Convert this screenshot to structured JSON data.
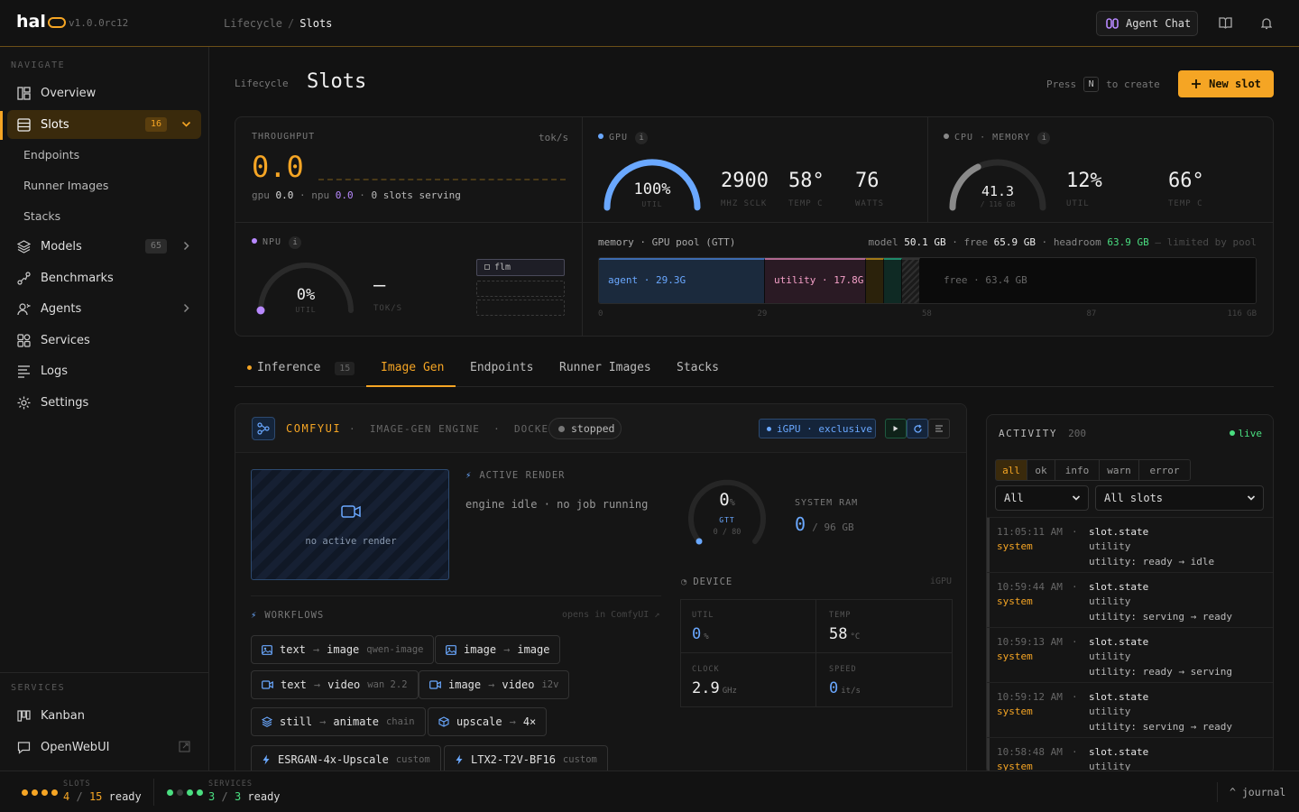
{
  "app": {
    "name": "hal",
    "version": "v1.0.0rc12"
  },
  "breadcrumb": {
    "parent": "Lifecycle",
    "current": "Slots"
  },
  "topbar": {
    "agent_chat": "Agent Chat"
  },
  "sidebar": {
    "nav_heading": "NAVIGATE",
    "items": [
      {
        "label": "Overview",
        "icon": "overview-icon"
      },
      {
        "label": "Slots",
        "icon": "slots-icon",
        "badge": "16"
      },
      {
        "label": "Models",
        "icon": "layers-icon",
        "badge": "65"
      },
      {
        "label": "Benchmarks",
        "icon": "benchmark-icon"
      },
      {
        "label": "Agents",
        "icon": "agents-icon"
      },
      {
        "label": "Services",
        "icon": "services-icon"
      },
      {
        "label": "Logs",
        "icon": "logs-icon"
      },
      {
        "label": "Settings",
        "icon": "gear-icon"
      }
    ],
    "sub_items": [
      "Endpoints",
      "Runner Images",
      "Stacks"
    ],
    "services_heading": "SERVICES",
    "services": [
      {
        "label": "Kanban",
        "icon": "kanban-icon"
      },
      {
        "label": "OpenWebUI",
        "icon": "chat-icon"
      }
    ]
  },
  "page": {
    "section": "Lifecycle",
    "title": "Slots",
    "press": "Press",
    "key": "N",
    "to_create": "to create",
    "new_slot": "New slot"
  },
  "throughput": {
    "label": "THROUGHPUT",
    "unit": "tok/s",
    "value": "0.0",
    "gpu_label": "gpu",
    "gpu_value": "0.0",
    "npu_label": "npu",
    "npu_value": "0.0",
    "serving": "0 slots serving"
  },
  "gpu": {
    "label": "GPU",
    "info": "i",
    "util": 100,
    "util_text": "100%",
    "util_label": "UTIL",
    "sclk": "2900",
    "sclk_label": "MHZ SCLK",
    "temp": "58°",
    "temp_label": "TEMP C",
    "watts": "76",
    "watts_label": "WATTS"
  },
  "cpu": {
    "label": "CPU",
    "sep": "·",
    "label2": "MEMORY",
    "info": "i",
    "mem_used": "41.3",
    "mem_total_text": "/ 116 GB",
    "mem_fraction": 0.356,
    "util": "12%",
    "util_label": "UTIL",
    "temp": "66°",
    "temp_label": "TEMP C"
  },
  "npu": {
    "label": "NPU",
    "info": "i",
    "util": 0,
    "util_text": "0%",
    "util_label": "UTIL",
    "toks": "–",
    "toks_label": "TOK/S",
    "slot_name": "flm"
  },
  "memory": {
    "title": "memory · GPU pool (GTT)",
    "model_label": "model",
    "model_value": "50.1 GB",
    "free_label": "free",
    "free_value": "65.9 GB",
    "headroom_label": "headroom",
    "headroom_value": "63.9 GB",
    "limited": "— limited by pool",
    "total_gb": 116,
    "segments": [
      {
        "label": "agent · 29.3G",
        "gb": 29.3,
        "color": "#1b2a3d",
        "edge": "#3d6bb0",
        "text": "#6aa8ff"
      },
      {
        "label": "utility · 17.8G",
        "gb": 17.8,
        "color": "#2a1a24",
        "edge": "#b06890",
        "text": "#f5a0c8"
      },
      {
        "label": "",
        "gb": 3.2,
        "color": "#2b220b",
        "edge": "#a07818",
        "text": "#f5a524"
      },
      {
        "label": "",
        "gb": 3.2,
        "color": "#0f2a24",
        "edge": "#1f8a6a",
        "text": "#4ade80"
      },
      {
        "label": "",
        "gb": 3.2,
        "color": "hatch",
        "edge": "#333",
        "text": "#888"
      },
      {
        "label": "free · 63.4 GB",
        "gb": 59.3,
        "color": "#0b0b0b",
        "edge": "#0b0b0b",
        "text": "#666"
      }
    ],
    "ticks": [
      "0",
      "29",
      "58",
      "87",
      "116 GB"
    ]
  },
  "tabs": [
    {
      "label": "Inference",
      "badge": "15"
    },
    {
      "label": "Image Gen"
    },
    {
      "label": "Endpoints"
    },
    {
      "label": "Runner Images"
    },
    {
      "label": "Stacks"
    }
  ],
  "comfy": {
    "name": "COMFYUI",
    "sep": "·",
    "engine": "IMAGE-GEN ENGINE",
    "runtime": "DOCKER",
    "status": "stopped",
    "gpu_badge": "iGPU · exclusive",
    "no_render": "no active render",
    "active_render_label": "ACTIVE RENDER",
    "idle": "engine idle · no job running",
    "gtt": {
      "value": "0",
      "pct": "%",
      "label": "GTT",
      "sub": "0 / 80",
      "fraction": 0
    },
    "ram": {
      "label": "SYSTEM RAM",
      "value": "0",
      "total": "/ 96 GB"
    },
    "device": {
      "label": "DEVICE",
      "tag": "iGPU",
      "util_label": "UTIL",
      "util_value": "0",
      "util_unit": "%",
      "temp_label": "TEMP",
      "temp_value": "58",
      "temp_unit": "°C",
      "clock_label": "CLOCK",
      "clock_value": "2.9",
      "clock_unit": "GHz",
      "speed_label": "SPEED",
      "speed_value": "0",
      "speed_unit": "it/s"
    },
    "workflows_label": "WORKFLOWS",
    "opens": "opens in ComfyUI ↗",
    "workflows": [
      {
        "icon": "image-icon",
        "from": "text",
        "to": "image",
        "tag": "qwen-image"
      },
      {
        "icon": "image-icon",
        "from": "image",
        "to": "image",
        "tag": ""
      },
      {
        "icon": "video-icon",
        "from": "text",
        "to": "video",
        "tag": "wan 2.2"
      },
      {
        "icon": "video-icon",
        "from": "image",
        "to": "video",
        "tag": "i2v"
      },
      {
        "icon": "layers-icon",
        "from": "still",
        "to": "animate",
        "tag": "chain"
      },
      {
        "icon": "cube-icon",
        "from": "upscale",
        "to": "4×",
        "tag": ""
      },
      {
        "icon": "bolt-icon",
        "from": "ESRGAN-4x-Upscale",
        "to": "",
        "tag": "custom"
      },
      {
        "icon": "bolt-icon",
        "from": "LTX2-T2V-BF16",
        "to": "",
        "tag": "custom"
      }
    ]
  },
  "activity": {
    "title": "ACTIVITY",
    "count": "200",
    "live": "live",
    "filters": [
      "all",
      "ok",
      "info",
      "warn",
      "error"
    ],
    "select_kind": "All",
    "select_slot": "All slots",
    "events": [
      {
        "time": "11:05:11 AM",
        "source": "system",
        "type": "slot.state",
        "slot": "utility",
        "msg": "utility: ready → idle"
      },
      {
        "time": "10:59:44 AM",
        "source": "system",
        "type": "slot.state",
        "slot": "utility",
        "msg": "utility: serving → ready"
      },
      {
        "time": "10:59:13 AM",
        "source": "system",
        "type": "slot.state",
        "slot": "utility",
        "msg": "utility: ready → serving"
      },
      {
        "time": "10:59:12 AM",
        "source": "system",
        "type": "slot.state",
        "slot": "utility",
        "msg": "utility: serving → ready"
      },
      {
        "time": "10:58:48 AM",
        "source": "system",
        "type": "slot.state",
        "slot": "utility",
        "msg": ""
      }
    ]
  },
  "footer": {
    "slots_label": "SLOTS",
    "slots_ready": "4",
    "slots_total": "15",
    "slots_word": "ready",
    "services_label": "SERVICES",
    "services_ready": "3",
    "services_total": "3",
    "services_word": "ready",
    "journal": "^ journal"
  }
}
